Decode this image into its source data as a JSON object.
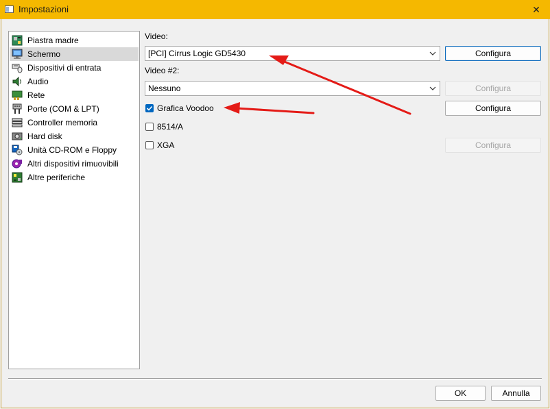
{
  "window": {
    "title": "Impostazioni",
    "close_glyph": "✕"
  },
  "sidebar": {
    "items": [
      {
        "label": "Piastra madre",
        "icon": "motherboard-icon"
      },
      {
        "label": "Schermo",
        "icon": "display-icon",
        "selected": true
      },
      {
        "label": "Dispositivi di entrata",
        "icon": "input-devices-icon"
      },
      {
        "label": "Audio",
        "icon": "speaker-icon"
      },
      {
        "label": "Rete",
        "icon": "network-icon"
      },
      {
        "label": "Porte (COM & LPT)",
        "icon": "ports-icon"
      },
      {
        "label": "Controller memoria",
        "icon": "storage-controller-icon"
      },
      {
        "label": "Hard disk",
        "icon": "hard-disk-icon"
      },
      {
        "label": "Unità CD-ROM e Floppy",
        "icon": "cdrom-floppy-icon"
      },
      {
        "label": "Altri dispositivi rimuovibili",
        "icon": "removable-devices-icon"
      },
      {
        "label": "Altre periferiche",
        "icon": "other-peripherals-icon"
      }
    ]
  },
  "video": {
    "label": "Video:",
    "value": "[PCI] Cirrus Logic GD5430",
    "configure": "Configura"
  },
  "video2": {
    "label": "Video #2:",
    "value": "Nessuno",
    "configure": "Configura"
  },
  "options": {
    "voodoo": {
      "label": "Grafica Voodoo",
      "checked": true,
      "configure": "Configura"
    },
    "ibm8514": {
      "label": "8514/A",
      "checked": false
    },
    "xga": {
      "label": "XGA",
      "checked": false,
      "configure": "Configura"
    }
  },
  "footer": {
    "ok": "OK",
    "cancel": "Annulla"
  },
  "colors": {
    "titlebar": "#f5b800",
    "accent": "#0067c0",
    "annotation_arrow": "#e41b17"
  }
}
